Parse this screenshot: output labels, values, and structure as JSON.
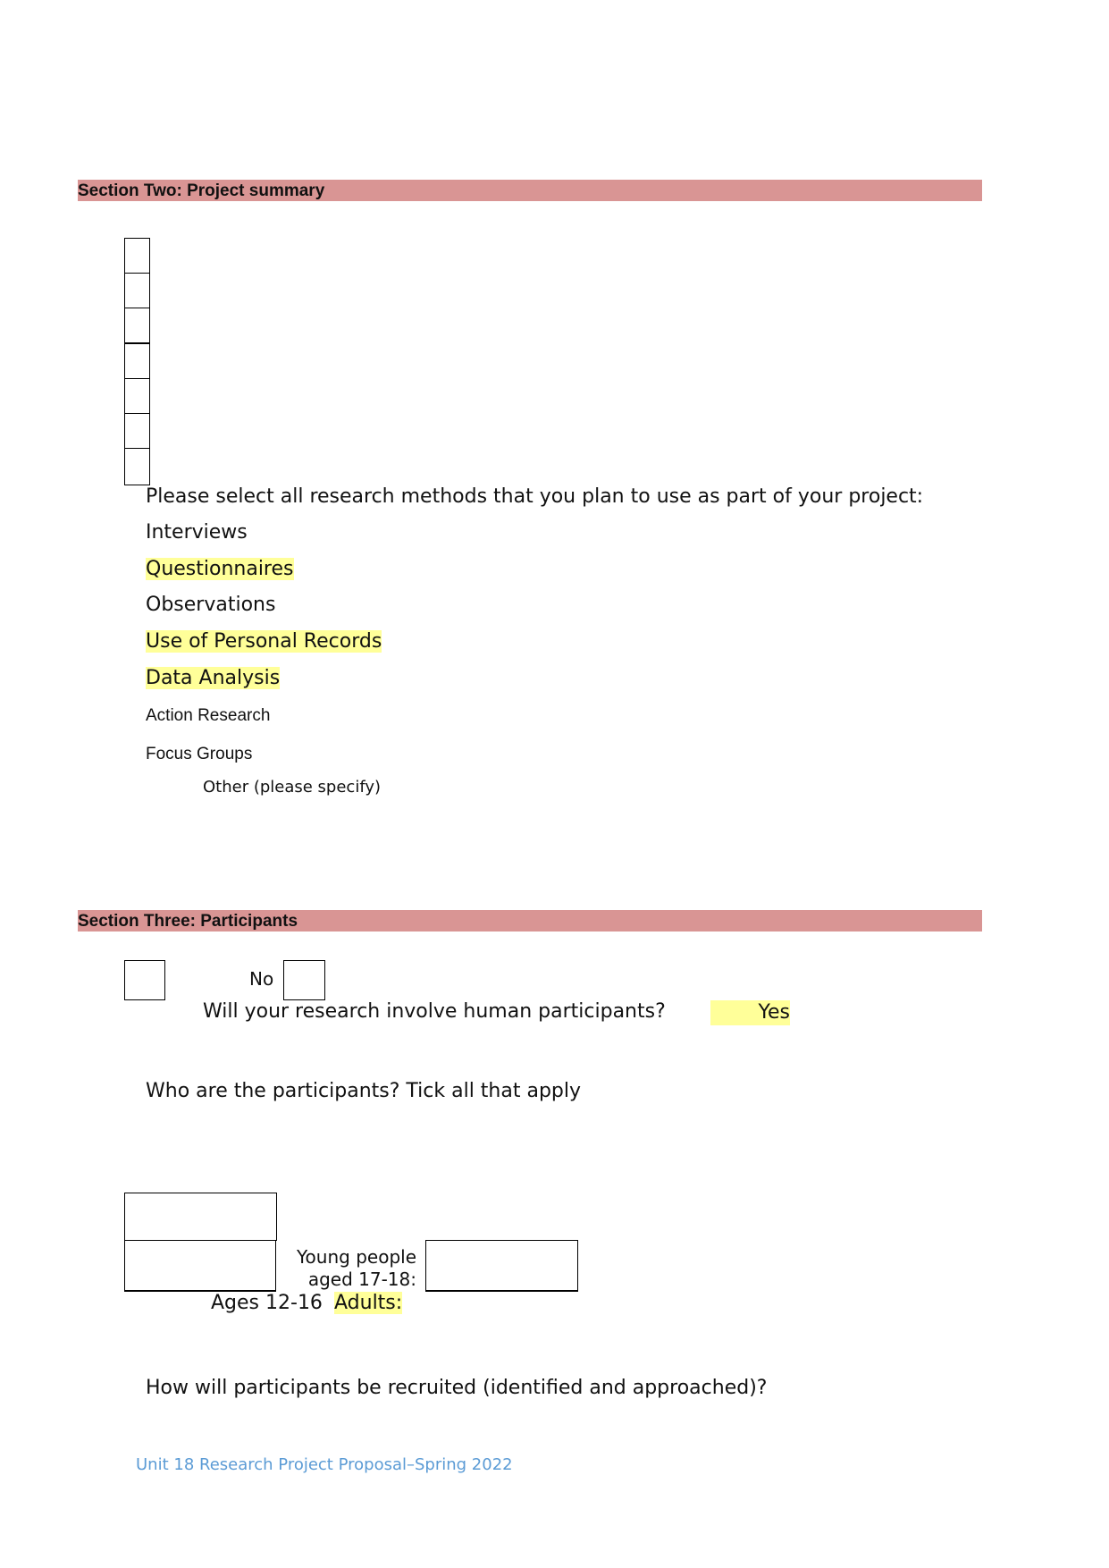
{
  "section_two": {
    "title": "Section Two: Project summary",
    "prompt": "Please select all research methods that you plan to use as part of your project:",
    "methods": [
      {
        "label": "Interviews",
        "highlighted": false
      },
      {
        "label": "Questionnaires",
        "highlighted": true
      },
      {
        "label": "Observations",
        "highlighted": false
      },
      {
        "label": "Use of Personal Records",
        "highlighted": true
      },
      {
        "label": "Data Analysis",
        "highlighted": true
      },
      {
        "label": "Action Research",
        "highlighted": false
      },
      {
        "label": "Focus Groups",
        "highlighted": false
      },
      {
        "label": "Other (please specify)",
        "highlighted": false
      }
    ]
  },
  "section_three": {
    "title": "Section Three: Participants",
    "human_question": "Will your research involve human participants?",
    "yes_label": "Yes",
    "no_label": "No",
    "who_question": "Who are the participants? Tick all that apply",
    "young_people_line1": "Young people",
    "young_people_line2": "aged 17-18:",
    "ages_label": "Ages 12-16",
    "adults_label": "Adults:",
    "recruit_question": "How will participants be recruited (identified and approached)?"
  },
  "footer": {
    "text": "Unit 18 Research Project Proposal–Spring 2022"
  },
  "colors": {
    "section_bar": "#d99594",
    "highlight": "#ffff99",
    "footer": "#5b9bd5"
  }
}
